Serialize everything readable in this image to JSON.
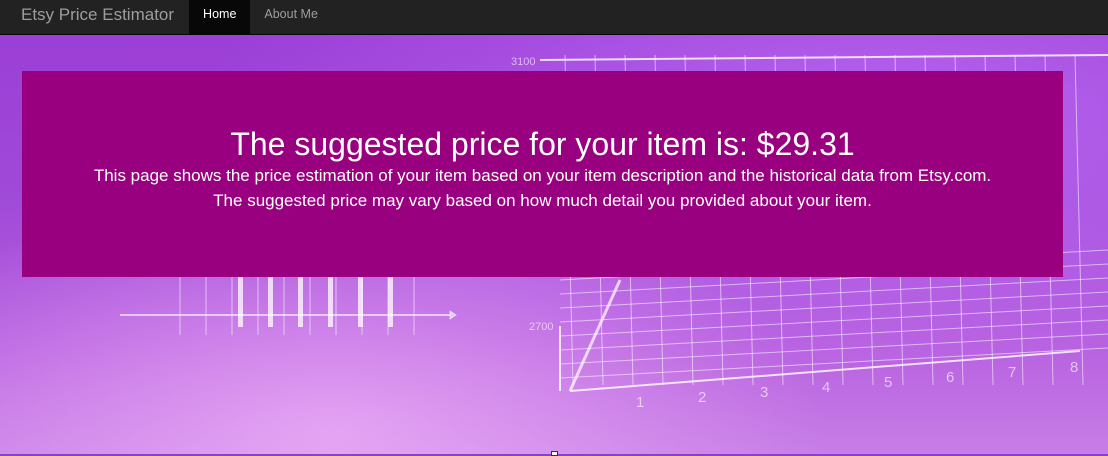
{
  "navbar": {
    "brand": "Etsy Price Estimator",
    "items": [
      {
        "label": "Home",
        "active": true
      },
      {
        "label": "About Me",
        "active": false
      }
    ]
  },
  "background": {
    "chart_labels": {
      "y_top": "3100",
      "y_mid": "2700",
      "x_ticks": [
        "1",
        "2",
        "3",
        "4",
        "5",
        "6",
        "7",
        "8"
      ]
    }
  },
  "result": {
    "headline": "The suggested price for your item is: $29.31",
    "line1": "This page shows the price estimation of your item based on your item description and the historical data from Etsy.com.",
    "line2": "The suggested price may vary based on how much detail you provided about your item."
  },
  "colors": {
    "navbar": "#222222",
    "jumbotron": "#990080",
    "text": "#ffffff"
  }
}
